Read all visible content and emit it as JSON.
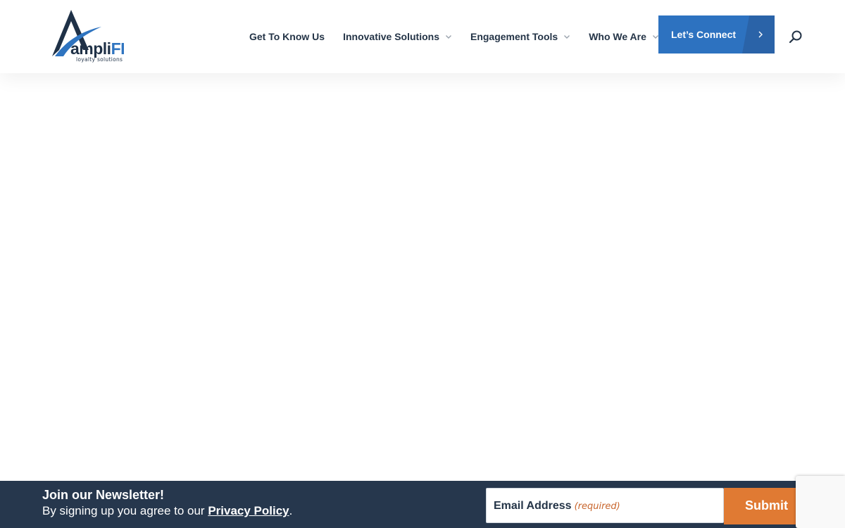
{
  "header": {
    "logo": {
      "name": "ampli",
      "accent": "FI",
      "tagline": "loyalty solutions"
    },
    "nav": [
      {
        "label": "Get To Know Us",
        "has_dropdown": false
      },
      {
        "label": "Innovative Solutions",
        "has_dropdown": true
      },
      {
        "label": "Engagement Tools",
        "has_dropdown": true
      },
      {
        "label": "Who We Are",
        "has_dropdown": true
      }
    ],
    "cta_label": "Let’s Connect",
    "search_icon": "search-icon"
  },
  "newsletter": {
    "title": "Join our Newsletter!",
    "text_prefix": "By signing up you agree to our ",
    "link_label": "Privacy Policy",
    "text_suffix": ".",
    "email_label": "Email Address",
    "email_required": "(required)",
    "email_value": "",
    "submit_label": "Submit"
  },
  "colors": {
    "brand_blue": "#2d72c0",
    "nav_text": "#243447",
    "footer_bg": "#26374d",
    "submit_orange": "#e07a33"
  }
}
